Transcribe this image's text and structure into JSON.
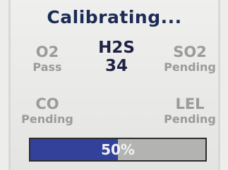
{
  "title": "Calibrating...",
  "gases": {
    "o2": {
      "name": "O2",
      "status": "Pass"
    },
    "h2s": {
      "name": "H2S",
      "status": "34"
    },
    "so2": {
      "name": "SO2",
      "status": "Pending"
    },
    "co": {
      "name": "CO",
      "status": "Pending"
    },
    "lel": {
      "name": "LEL",
      "status": "Pending"
    }
  },
  "progress": {
    "value": 0.5,
    "label": "50%"
  },
  "colors": {
    "title": "#1c2b55",
    "active_text": "#1e2242",
    "inactive_text": "#9c9a9b",
    "progress_fill": "#34419a",
    "progress_track": "#b3b3b2"
  }
}
